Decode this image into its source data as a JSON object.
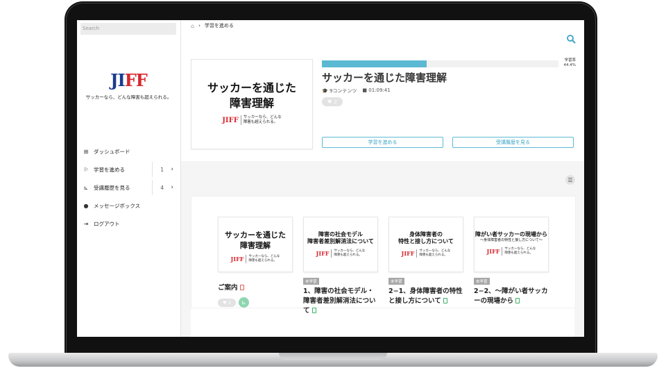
{
  "sidebar": {
    "search_placeholder": "Search",
    "logo": {
      "mark_left": "JI",
      "mark_right": "FF"
    },
    "tagline": "サッカーなら、どんな障害も超えられる。",
    "items": [
      {
        "icon": "dashboard-icon",
        "label": "ダッシュボード"
      },
      {
        "icon": "flag-icon",
        "label": "学習を進める",
        "count": "1"
      },
      {
        "icon": "chart-icon",
        "label": "受講履歴を見る",
        "count": "4"
      },
      {
        "icon": "chat-icon",
        "label": "メッセージボックス"
      },
      {
        "icon": "logout-icon",
        "label": "ログアウト"
      }
    ]
  },
  "breadcrumb": {
    "current": "学習を進める"
  },
  "course": {
    "thumb_title_line1": "サッカーを通じた",
    "thumb_title_line2": "障害理解",
    "mini_logo_mark": "JIFF",
    "mini_logo_text_1": "サッカーなら、どんな",
    "mini_logo_text_2": "障害も超えられる。",
    "title": "サッカーを通じた障害理解",
    "contents": "9コンテンツ",
    "duration": "01:09:41",
    "likes": "2",
    "progress_label": "学習率",
    "progress_value": "44.4%",
    "progress_fraction": 0.444,
    "btn_continue": "学習を進める",
    "btn_history": "受講履歴を見る"
  },
  "items": [
    {
      "thumb_line1": "サッカーを通じた",
      "thumb_line2": "障害理解",
      "title": "ご案内",
      "file": "pdf",
      "likes": "2"
    },
    {
      "thumb_line1": "障害の社会モデル",
      "thumb_line2": "障害者差別解消法について",
      "badge": "未学習",
      "title": "1、障害の社会モデル・障害者差別解消法について",
      "file": "doc"
    },
    {
      "thumb_line1": "身体障害者の",
      "thumb_line2": "特性と接し方について",
      "badge": "未学習",
      "title": "2−1、身体障害者の特性と接し方について",
      "file": "doc"
    },
    {
      "thumb_line1": "障がい者サッカーの現場から",
      "thumb_sub": "〜身体障害者の特性と接し方について〜",
      "badge": "未学習",
      "title": "2−2、〜障がい者サッカーの現場から",
      "file": "doc"
    }
  ],
  "colors": {
    "accent": "#5bb9d3",
    "logo_red": "#d7282f",
    "logo_blue": "#1b3b8f"
  }
}
